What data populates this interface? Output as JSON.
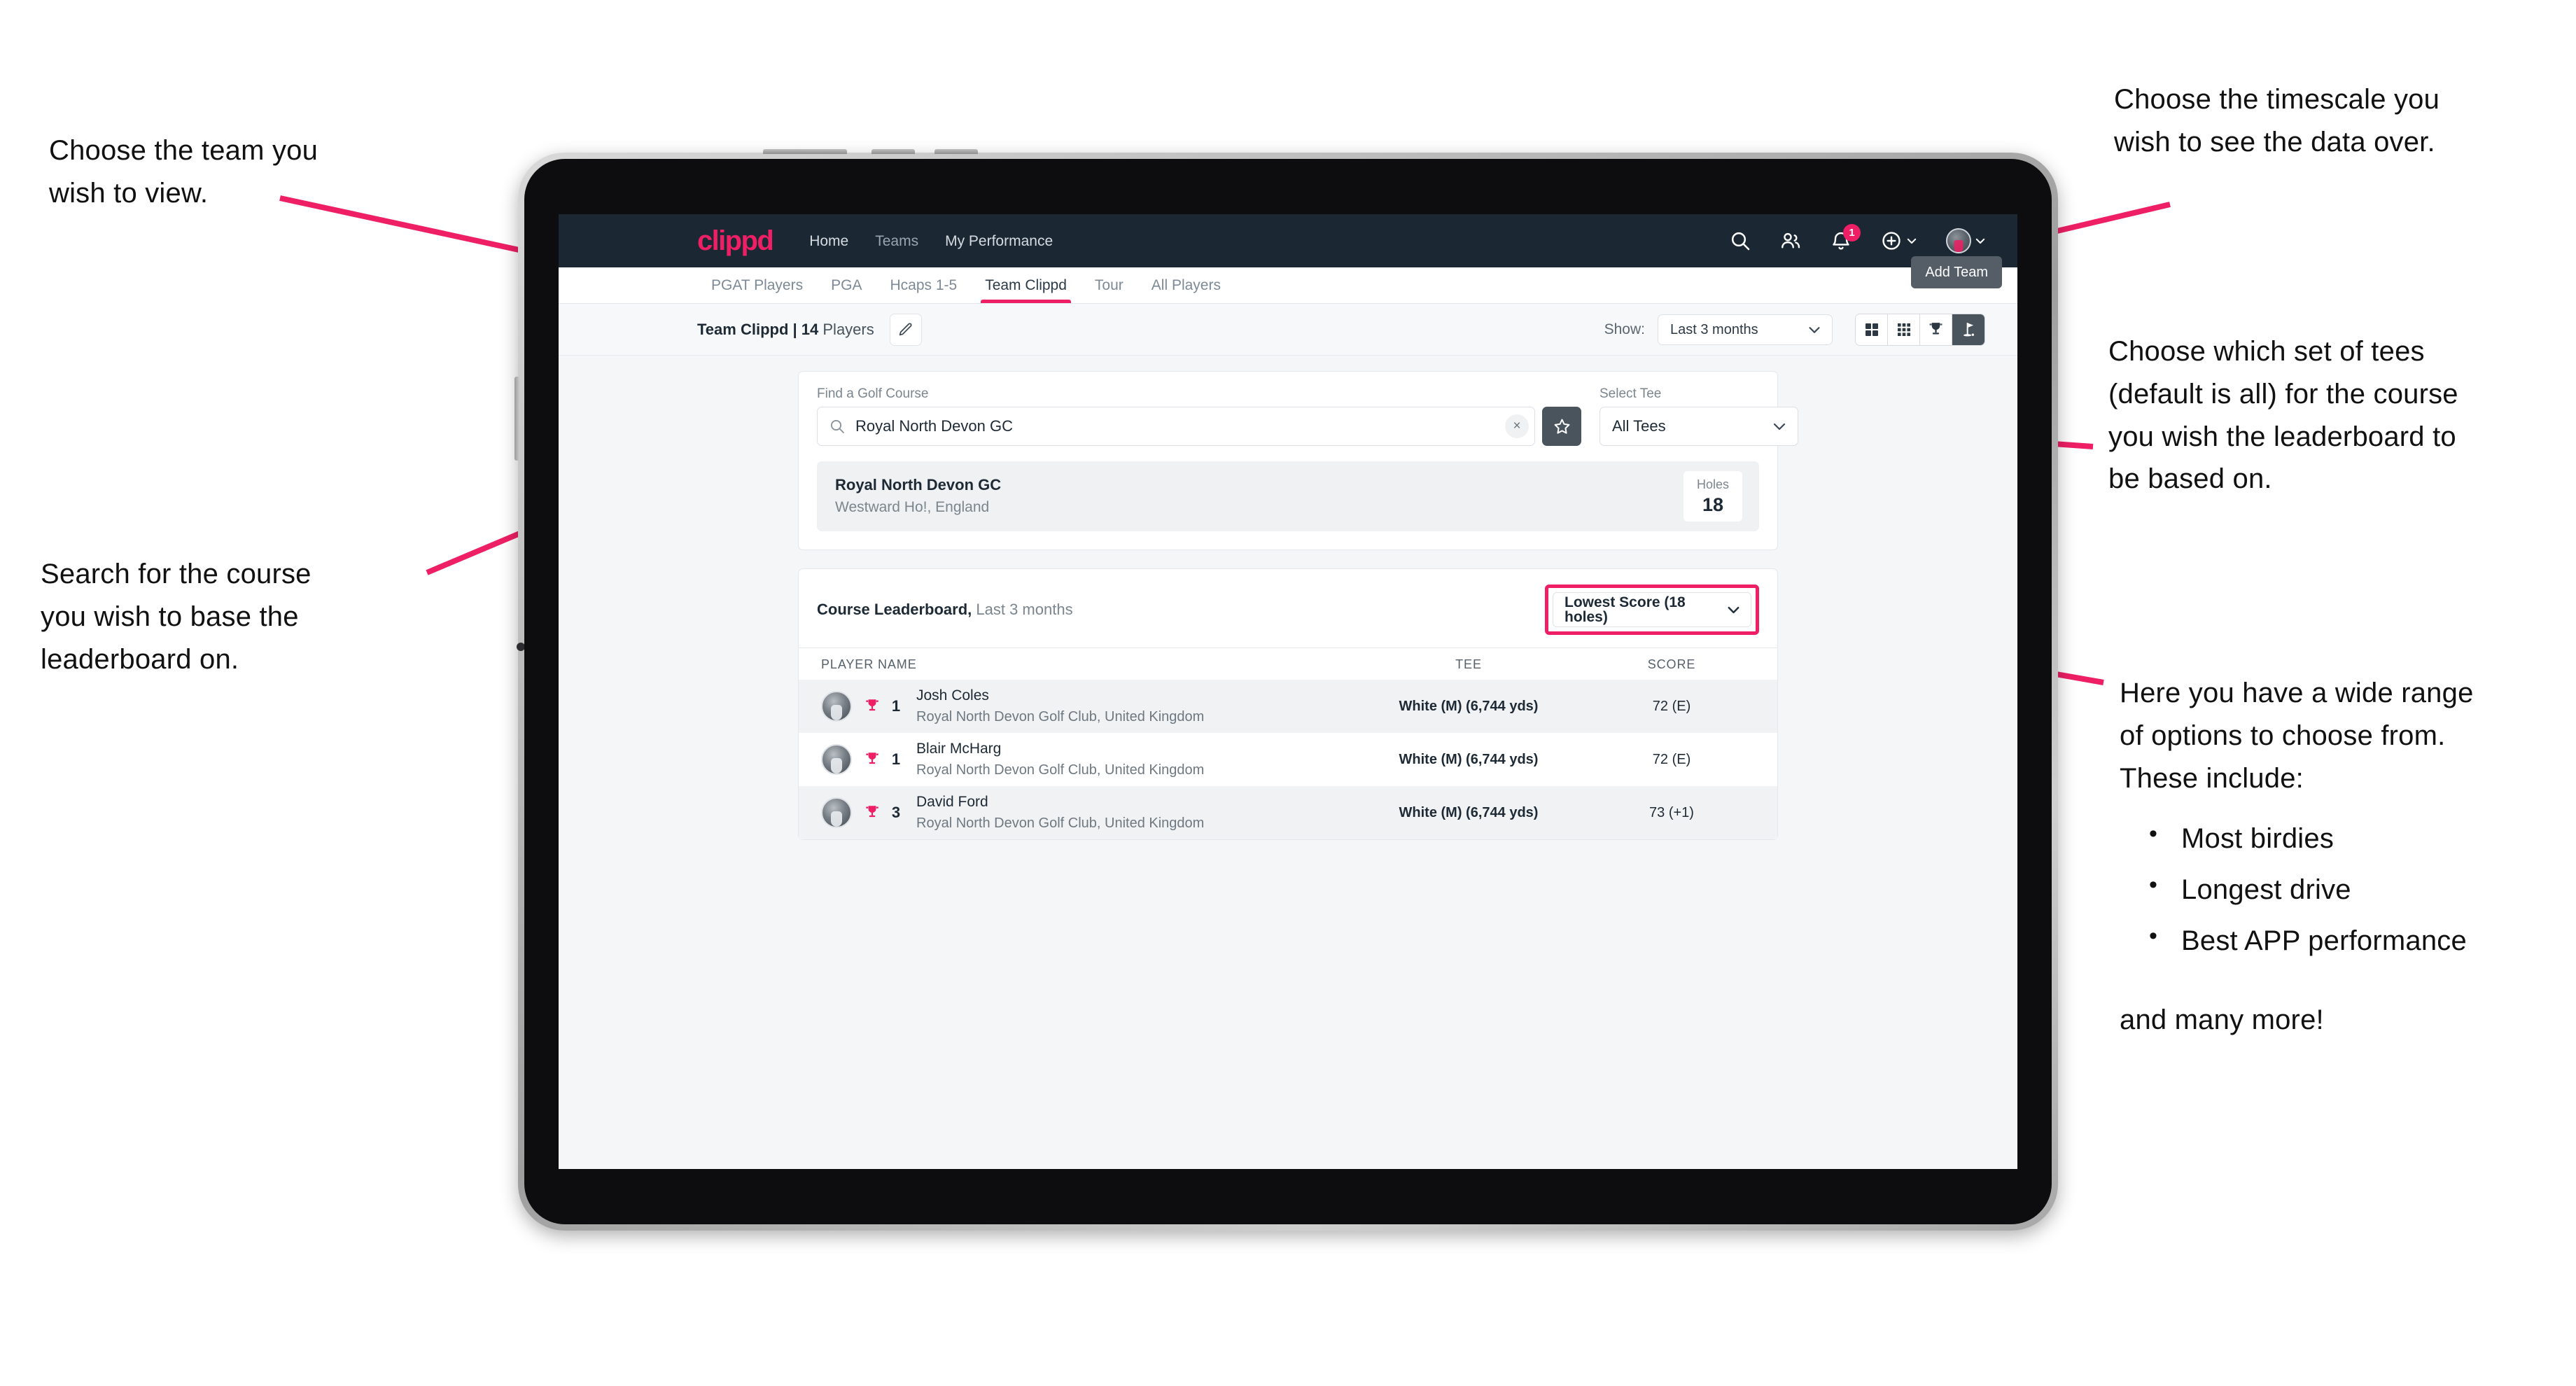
{
  "annotations": {
    "team": "Choose the team you\nwish to view.",
    "search": "Search for the course\nyou wish to base the\nleaderboard on.",
    "timescale": "Choose the timescale you\nwish to see the data over.",
    "tees": "Choose which set of tees\n(default is all) for the course\nyou wish the leaderboard to\nbe based on.",
    "options_intro": "Here you have a wide range\nof options to choose from.\nThese include:",
    "options_list": [
      "Most birdies",
      "Longest drive",
      "Best APP performance"
    ],
    "options_outro": "and many more!"
  },
  "app": {
    "brand": "clippd",
    "nav": [
      {
        "label": "Home",
        "active": true
      },
      {
        "label": "Teams",
        "active": false
      },
      {
        "label": "My Performance",
        "active": true
      }
    ],
    "icons": {
      "search": "search-icon",
      "people": "people-icon",
      "notifications": "bell-icon",
      "add": "plus-circle-icon",
      "profile": "avatar-icon"
    },
    "notification_count": "1"
  },
  "tabs": [
    {
      "label": "PGAT Players",
      "active": false
    },
    {
      "label": "PGA",
      "active": false
    },
    {
      "label": "Hcaps 1-5",
      "active": false
    },
    {
      "label": "Team Clippd",
      "active": true
    },
    {
      "label": "Tour",
      "active": false
    },
    {
      "label": "All Players",
      "active": false
    }
  ],
  "tooltip": "Add Team",
  "toolbar": {
    "team_name": "Team Clippd",
    "separator": " | ",
    "player_count": "14",
    "players_word": " Players",
    "edit_icon": "pencil-icon",
    "show_label": "Show:",
    "period_value": "Last 3 months",
    "views": [
      {
        "name": "grid-large-view",
        "selected": false
      },
      {
        "name": "grid-small-view",
        "selected": false
      },
      {
        "name": "trophy-view",
        "selected": false
      },
      {
        "name": "course-flag-view",
        "selected": true
      }
    ]
  },
  "search": {
    "course_label": "Find a Golf Course",
    "course_value": "Royal North Devon GC",
    "clear_label": "×",
    "star_icon": "star-icon",
    "tee_label": "Select Tee",
    "tee_value": "All Tees"
  },
  "course": {
    "name": "Royal North Devon GC",
    "location": "Westward Ho!, England",
    "holes_label": "Holes",
    "holes_value": "18"
  },
  "leaderboard": {
    "title": "Course Leaderboard,",
    "subtitle": " Last 3 months",
    "sort_value": "Lowest Score (18 holes)",
    "columns": [
      "PLAYER NAME",
      "TEE",
      "SCORE"
    ],
    "rows": [
      {
        "rank": "1",
        "name": "Josh Coles",
        "club": "Royal North Devon Golf Club, United Kingdom",
        "tee": "White (M) (6,744 yds)",
        "score": "72 (E)"
      },
      {
        "rank": "1",
        "name": "Blair McHarg",
        "club": "Royal North Devon Golf Club, United Kingdom",
        "tee": "White (M) (6,744 yds)",
        "score": "72 (E)"
      },
      {
        "rank": "3",
        "name": "David Ford",
        "club": "Royal North Devon Golf Club, United Kingdom",
        "tee": "White (M) (6,744 yds)",
        "score": "73 (+1)"
      }
    ]
  },
  "colors": {
    "accent": "#ee1f64",
    "appbar": "#1b2834",
    "screen_bg": "#f5f6f8",
    "dark_button": "#4a545d"
  }
}
